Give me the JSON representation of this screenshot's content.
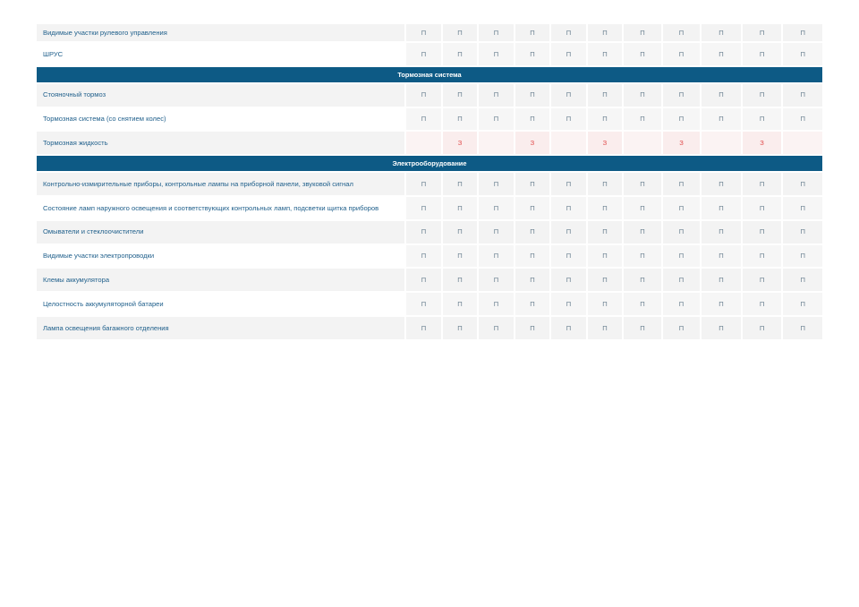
{
  "rows": [
    {
      "type": "row",
      "name": "Видимые участки рулевого управления",
      "cells": [
        "П",
        "П",
        "П",
        "П",
        "П",
        "П",
        "П",
        "П",
        "П",
        "П",
        "П"
      ]
    },
    {
      "type": "row",
      "name": "ШРУС",
      "cells": [
        "П",
        "П",
        "П",
        "П",
        "П",
        "П",
        "П",
        "П",
        "П",
        "П",
        "П"
      ]
    },
    {
      "type": "section",
      "name": "Тормозная система"
    },
    {
      "type": "row",
      "name": "Стояночный тормоз",
      "cells": [
        "П",
        "П",
        "П",
        "П",
        "П",
        "П",
        "П",
        "П",
        "П",
        "П",
        "П"
      ]
    },
    {
      "type": "row",
      "name": "Тормозная система (со снятием колес)",
      "cells": [
        "П",
        "П",
        "П",
        "П",
        "П",
        "П",
        "П",
        "П",
        "П",
        "П",
        "П"
      ]
    },
    {
      "type": "row",
      "name": "Тормозная жидкость",
      "cells": [
        "",
        "З",
        "",
        "З",
        "",
        "З",
        "",
        "З",
        "",
        "З",
        ""
      ]
    },
    {
      "type": "section",
      "name": "Электрооборудование"
    },
    {
      "type": "row",
      "name": "Контрольно-измирительные приборы, контрольные лампы на приборной панели, звуковой сигнал",
      "cells": [
        "П",
        "П",
        "П",
        "П",
        "П",
        "П",
        "П",
        "П",
        "П",
        "П",
        "П"
      ]
    },
    {
      "type": "row",
      "name": "Состояние ламп наружного освещения и соответствующих контрольных ламп, подсветки щитка приборов",
      "cells": [
        "П",
        "П",
        "П",
        "П",
        "П",
        "П",
        "П",
        "П",
        "П",
        "П",
        "П"
      ]
    },
    {
      "type": "row",
      "name": "Омыватели и стеклоочистители",
      "cells": [
        "П",
        "П",
        "П",
        "П",
        "П",
        "П",
        "П",
        "П",
        "П",
        "П",
        "П"
      ]
    },
    {
      "type": "row",
      "name": "Видимые участки электропроводки",
      "cells": [
        "П",
        "П",
        "П",
        "П",
        "П",
        "П",
        "П",
        "П",
        "П",
        "П",
        "П"
      ]
    },
    {
      "type": "row",
      "name": "Клемы аккумулятора",
      "cells": [
        "П",
        "П",
        "П",
        "П",
        "П",
        "П",
        "П",
        "П",
        "П",
        "П",
        "П"
      ]
    },
    {
      "type": "row",
      "name": "Целостность аккумуляторной батареи",
      "cells": [
        "П",
        "П",
        "П",
        "П",
        "П",
        "П",
        "П",
        "П",
        "П",
        "П",
        "П"
      ]
    },
    {
      "type": "row",
      "name": "Лампа освещения багажного отделения",
      "cells": [
        "П",
        "П",
        "П",
        "П",
        "П",
        "П",
        "П",
        "П",
        "П",
        "П",
        "П"
      ]
    }
  ],
  "colors": {
    "section_bg": "#0d5a85",
    "name_text": "#1f5f8b",
    "cell_text": "#6b8191",
    "replace_text": "#e04a4a"
  }
}
